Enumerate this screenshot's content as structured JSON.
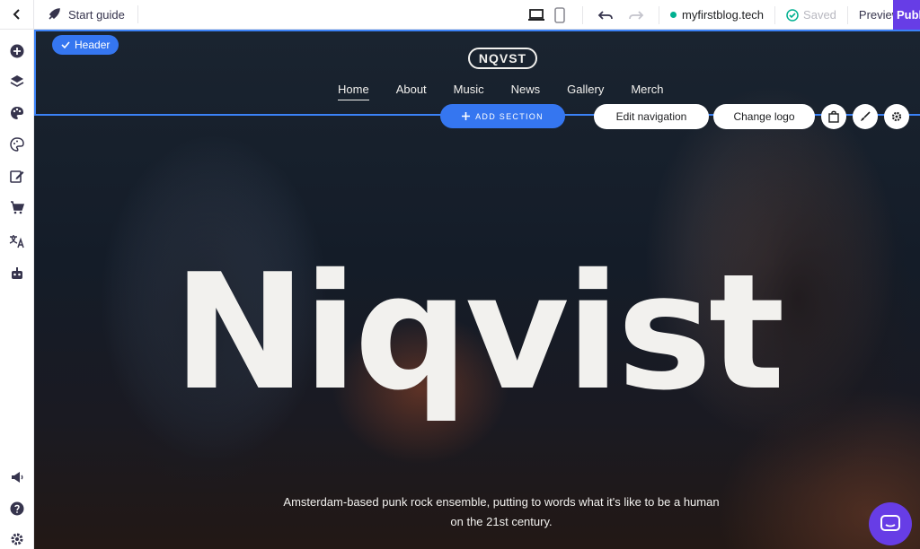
{
  "topbar": {
    "start_guide_label": "Start guide",
    "domain": "myfirstblog.tech",
    "saved_label": "Saved",
    "preview_label": "Preview",
    "publish_label": "Publish"
  },
  "sidebar": {
    "items": [
      {
        "name": "add-element",
        "icon": "plus-circle-icon"
      },
      {
        "name": "layers",
        "icon": "layers-icon"
      },
      {
        "name": "styles",
        "icon": "palette-icon"
      },
      {
        "name": "colors",
        "icon": "palette-outline-icon"
      },
      {
        "name": "blog",
        "icon": "edit-icon"
      },
      {
        "name": "store",
        "icon": "cart-icon"
      },
      {
        "name": "translate",
        "icon": "translate-icon"
      },
      {
        "name": "ai-tools",
        "icon": "robot-icon"
      },
      {
        "name": "marketing",
        "icon": "megaphone-icon"
      },
      {
        "name": "help",
        "icon": "help-icon"
      },
      {
        "name": "settings",
        "icon": "gear-icon"
      }
    ]
  },
  "editor": {
    "header_chip_label": "Header",
    "add_section_label": "ADD SECTION",
    "edit_navigation_label": "Edit navigation",
    "change_logo_label": "Change logo"
  },
  "site": {
    "logo_text": "NQVST",
    "nav": [
      "Home",
      "About",
      "Music",
      "News",
      "Gallery",
      "Merch"
    ],
    "active_nav": "Home",
    "hero_title": "Niqvist",
    "hero_description": "Amsterdam-based punk rock ensemble, putting to words what it's like to be a human on the 21st century."
  },
  "colors": {
    "accent": "#3576f0",
    "brand": "#673de6",
    "status_green": "#00b090"
  }
}
